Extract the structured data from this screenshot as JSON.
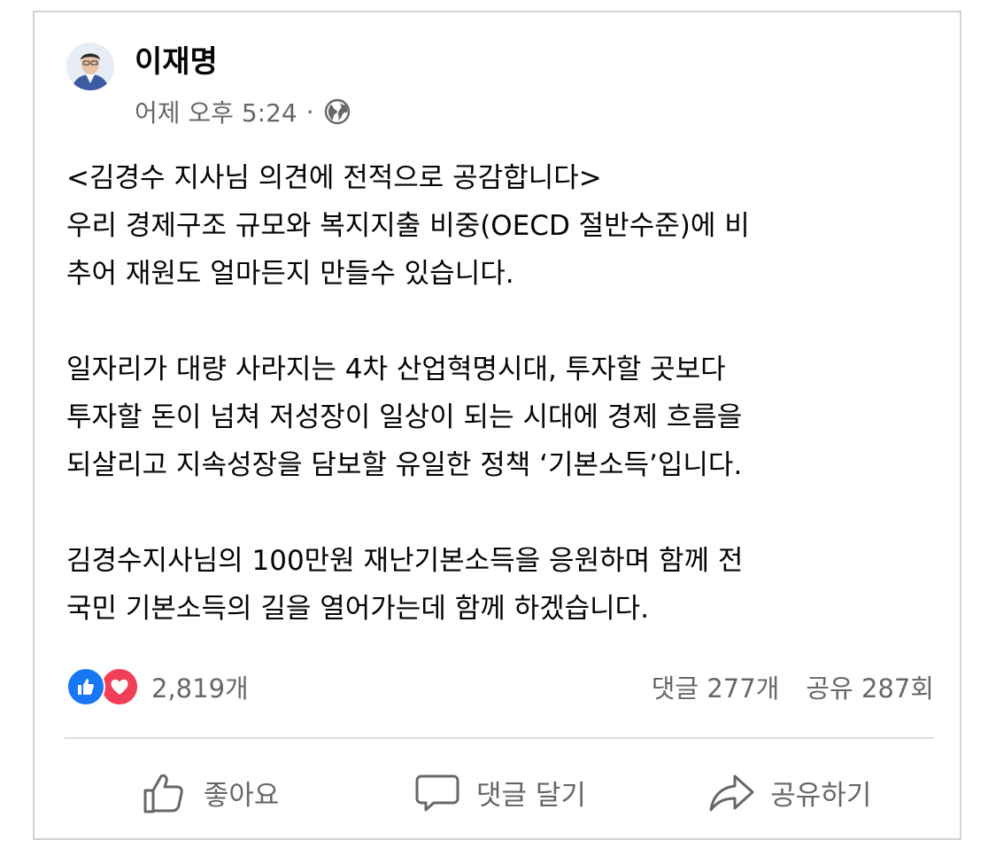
{
  "post": {
    "author": "이재명",
    "timestamp": "어제 오후 5:24",
    "separator": "·",
    "audience_icon": "globe-icon",
    "paragraphs": [
      {
        "lines": [
          "<김경수 지사님 의견에 전적으로 공감합니다>",
          "우리 경제구조 규모와 복지지출 비중(OECD 절반수준)에 비",
          "추어 재원도 얼마든지 만들수 있습니다."
        ]
      },
      {
        "lines": [
          "일자리가 대량 사라지는 4차 산업혁명시대, 투자할 곳보다",
          "투자할 돈이 넘쳐 저성장이 일상이 되는 시대에 경제 흐름을",
          "되살리고 지속성장을 담보할 유일한 정책 ‘기본소득’입니다."
        ]
      },
      {
        "lines": [
          "김경수지사님의 100만원 재난기본소득을 응원하며 함께 전",
          "국민 기본소득의 길을 열어가는데 함께 하겠습니다."
        ]
      }
    ]
  },
  "stats": {
    "reaction_icons": [
      "like-icon",
      "love-icon"
    ],
    "reactions_count": "2,819개",
    "comments_count": "댓글 277개",
    "shares_count": "공유 287회"
  },
  "actions": {
    "like_label": "좋아요",
    "comment_label": "댓글 달기",
    "share_label": "공유하기"
  },
  "colors": {
    "like_blue": "#1877f2",
    "love_red": "#f33e58",
    "secondary_text": "#65676b",
    "border": "#cfd2d6"
  }
}
